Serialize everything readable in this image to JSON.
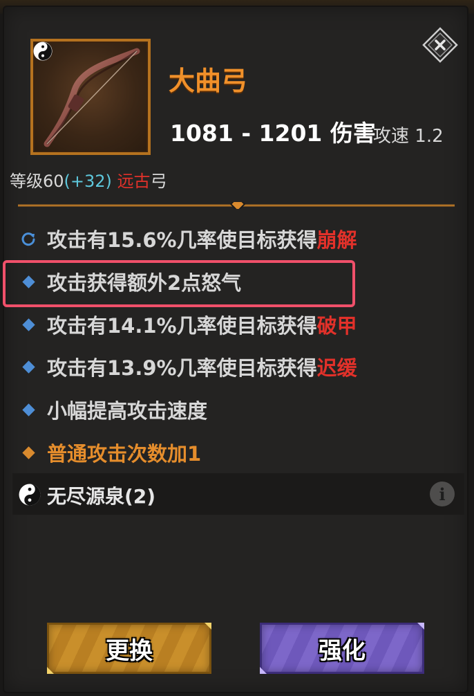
{
  "item": {
    "name": "大曲弓",
    "damage": "1081 - 1201 伤害",
    "attack_speed_label": "攻速",
    "attack_speed_value": "1.2",
    "level_prefix": "等级60",
    "level_bonus": "(+32)",
    "rarity": "远古",
    "type": "弓",
    "icon": "bow-icon",
    "set_icon": "yin-yang-icon"
  },
  "stats": [
    {
      "bullet": "refresh-icon",
      "text": "攻击有15.6%几率使目标获得",
      "keyword": "崩解"
    },
    {
      "bullet": "diamond-blue",
      "text": "攻击获得额外2点怒气",
      "keyword": ""
    },
    {
      "bullet": "diamond-blue",
      "text": "攻击有14.1%几率使目标获得",
      "keyword": "破甲"
    },
    {
      "bullet": "diamond-blue",
      "text": "攻击有13.9%几率使目标获得",
      "keyword": "迟缓"
    },
    {
      "bullet": "diamond-blue",
      "text": "小幅提高攻击速度",
      "keyword": ""
    },
    {
      "bullet": "diamond-orange",
      "text": "普通攻击次数加1",
      "keyword": ""
    }
  ],
  "set_bonus": {
    "label": "无尽源泉(2)",
    "info_icon": "i"
  },
  "buttons": {
    "swap": "更换",
    "enhance": "强化"
  },
  "colors": {
    "title_orange": "#f0902a",
    "keyword_red": "#e2312a",
    "bonus_cyan": "#5ec8dd",
    "highlight_pink": "#f0506a",
    "swap_gold": "#c98f2b",
    "enhance_purple": "#7d67c9"
  }
}
